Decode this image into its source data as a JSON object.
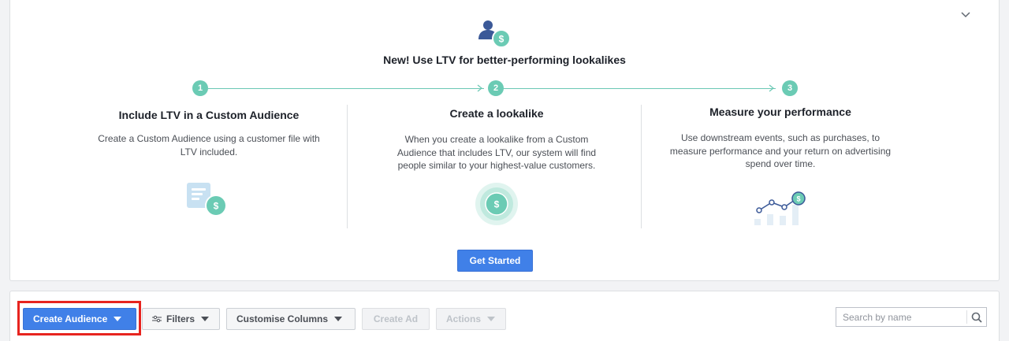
{
  "promo": {
    "title": "New! Use LTV for better-performing lookalikes",
    "steps": [
      {
        "number": "1",
        "title": "Include LTV in a Custom Audience",
        "description": "Create a Custom Audience using a customer file with LTV included."
      },
      {
        "number": "2",
        "title": "Create a lookalike",
        "description": "When you create a lookalike from a Custom Audience that includes LTV, our system will find people similar to your highest-value customers."
      },
      {
        "number": "3",
        "title": "Measure your performance",
        "description": "Use downstream events, such as purchases, to measure performance and your return on advertising spend over time."
      }
    ],
    "cta_label": "Get Started",
    "colors": {
      "accent_teal": "#6bcbb4",
      "primary_blue": "#4080e8"
    },
    "icons": [
      "person-dollar-icon",
      "document-dollar-icon",
      "target-dollar-icon",
      "chart-dollar-icon",
      "chevron-down-icon"
    ]
  },
  "toolbar": {
    "create_audience_label": "Create Audience",
    "filters_label": "Filters",
    "customise_columns_label": "Customise Columns",
    "create_ad_label": "Create Ad",
    "actions_label": "Actions",
    "search_placeholder": "Search by name",
    "icons": [
      "sliders-icon",
      "search-icon"
    ],
    "highlight_color": "#e7241f"
  }
}
